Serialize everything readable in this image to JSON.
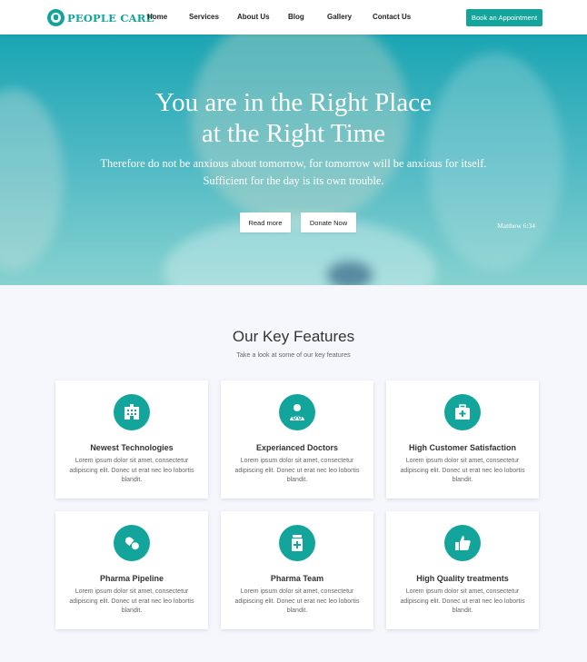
{
  "header": {
    "logo_text": "PEOPLE CARE",
    "nav": [
      "Home",
      "Services",
      "About Us",
      "Blog",
      "Gallery",
      "Contact Us"
    ],
    "cta_label": "Book an Appointment"
  },
  "hero": {
    "title_line1": "You are in the Right Place",
    "title_line2": "at the Right Time",
    "quote_line1": "Therefore do not be anxious about tomorrow, for tomorrow will be anxious for itself.",
    "quote_line2": "Sufficient for the day is its own trouble.",
    "attribution": "Matthew 6:34",
    "read_more_label": "Read more",
    "donate_label": "Donate Now"
  },
  "features": {
    "title": "Our Key Features",
    "subtitle": "Take a look at some of our key features",
    "cards": [
      {
        "icon": "hospital-icon",
        "title": "Newest Technologies",
        "text": "Lorem ipsum dolor sit amet, consectetur adipiscing elit. Donec ut erat nec leo lobortis blandit."
      },
      {
        "icon": "doctor-icon",
        "title": "Experianced Doctors",
        "text": "Lorem ipsum dolor sit amet, consectetur adipiscing elit. Donec ut erat nec leo lobortis blandit."
      },
      {
        "icon": "medical-kit-icon",
        "title": "High Customer Satisfaction",
        "text": "Lorem ipsum dolor sit amet, consectetur adipiscing elit. Donec ut erat nec leo lobortis blandit."
      },
      {
        "icon": "pills-icon",
        "title": "Pharma Pipeline",
        "text": "Lorem ipsum dolor sit amet, consectetur adipiscing elit. Donec ut erat nec leo lobortis blandit."
      },
      {
        "icon": "medicine-bottle-icon",
        "title": "Pharma Team",
        "text": "Lorem ipsum dolor sit amet, consectetur adipiscing elit. Donec ut erat nec leo lobortis blandit."
      },
      {
        "icon": "thumbs-up-icon",
        "title": "High Quality treatments",
        "text": "Lorem ipsum dolor sit amet, consectetur adipiscing elit. Donec ut erat nec leo lobortis blandit."
      }
    ]
  },
  "colors": {
    "accent": "#13a59b",
    "page_bg": "#f6f7fd"
  }
}
